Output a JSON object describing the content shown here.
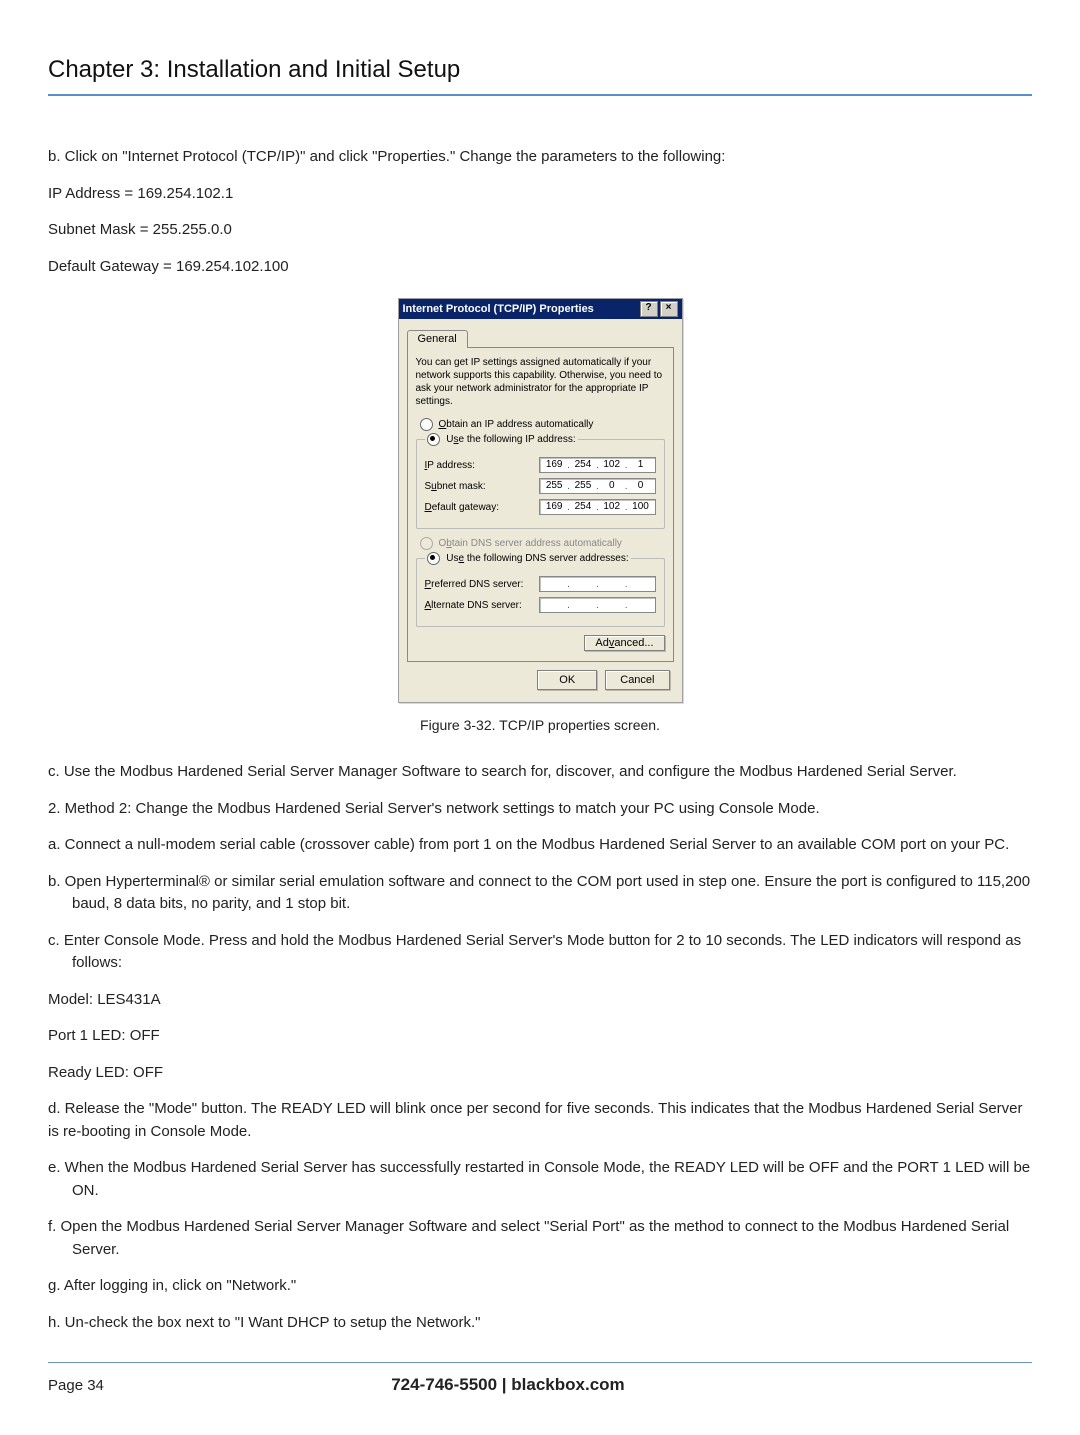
{
  "chapter_title": "Chapter 3: Installation and Initial Setup",
  "body": {
    "p_b": "b.  Click on \"Internet Protocol (TCP/IP)\" and click \"Properties.\" Change the parameters to the following:",
    "ip_line": "IP Address = 169.254.102.1",
    "mask_line": "Subnet Mask = 255.255.0.0",
    "gw_line": "Default Gateway = 169.254.102.100",
    "caption": "Figure 3-32. TCP/IP properties screen.",
    "p_c1": "c.  Use the Modbus Hardened Serial Server Manager Software to search for, discover, and configure the Modbus Hardened Serial Server.",
    "p_m2": "2.  Method 2: Change the Modbus Hardened Serial Server's network settings to match your PC using Console Mode.",
    "p_a2": "a.  Connect a null-modem serial cable (crossover cable) from port 1 on the Modbus Hardened Serial Server to an available COM port on your PC.",
    "p_b2": "b.  Open Hyperterminal® or similar serial emulation software and connect to the COM port used in step one. Ensure the port is configured to 115,200 baud, 8 data bits, no parity, and 1 stop bit.",
    "p_c2": "c.  Enter Console Mode. Press and hold the Modbus Hardened Serial Server's Mode button for 2 to 10 seconds. The LED indicators will respond as follows:",
    "model": "Model: LES431A",
    "port1": "Port 1 LED: OFF",
    "ready": "Ready LED: OFF",
    "p_d2": "d. Release the \"Mode\" button. The READY LED will blink once per second for five seconds. This indicates that the Modbus Hardened Serial Server is re-booting in Console Mode.",
    "p_e2": "e.  When the Modbus Hardened Serial Server has successfully restarted in Console Mode, the READY LED will be OFF and the PORT 1 LED will be ON.",
    "p_f2": "f.  Open the Modbus Hardened Serial Server Manager Software and select \"Serial Port\" as the method to connect to the Modbus Hardened Serial Server.",
    "p_g2": "g.  After logging in, click on \"Network.\"",
    "p_h2": "h.  Un-check the box next to \"I Want DHCP to setup the Network.\""
  },
  "dialog": {
    "title": "Internet Protocol (TCP/IP) Properties",
    "help": "?",
    "close": "×",
    "tab": "General",
    "intro": "You can get IP settings assigned automatically if your network supports this capability. Otherwise, you need to ask your network administrator for the appropriate IP settings.",
    "opt_auto_ip": "Obtain an IP address automatically",
    "opt_use_ip": "Use the following IP address:",
    "lbl_ip": "IP address:",
    "lbl_mask": "Subnet mask:",
    "lbl_gw": "Default gateway:",
    "ip": {
      "a": "169",
      "b": "254",
      "c": "102",
      "d": "1"
    },
    "mask": {
      "a": "255",
      "b": "255",
      "c": "0",
      "d": "0"
    },
    "gw": {
      "a": "169",
      "b": "254",
      "c": "102",
      "d": "100"
    },
    "opt_auto_dns": "Obtain DNS server address automatically",
    "opt_use_dns": "Use the following DNS server addresses:",
    "lbl_pref": "Preferred DNS server:",
    "lbl_alt": "Alternate DNS server:",
    "advanced": "Advanced...",
    "ok": "OK",
    "cancel": "Cancel"
  },
  "footer": {
    "page": "Page 34",
    "center": "724-746-5500   |   blackbox.com"
  }
}
